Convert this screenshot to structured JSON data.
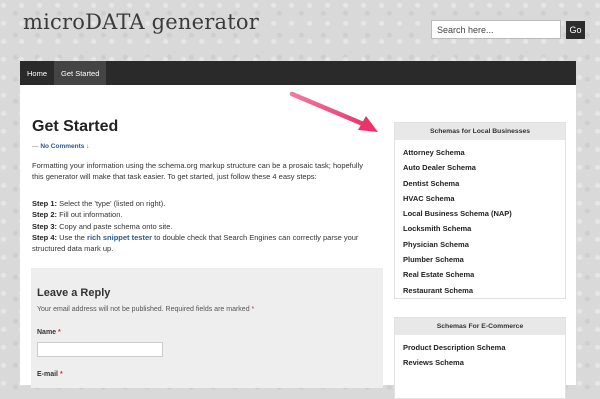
{
  "site": {
    "title": "microDATA generator"
  },
  "search": {
    "placeholder": "Search here...",
    "button_label": "Go"
  },
  "nav": {
    "items": [
      "Home",
      "Get Started"
    ]
  },
  "page": {
    "title": "Get Started",
    "meta_prefix": "— ",
    "meta_comments": "No Comments ↓",
    "intro": "Formatting your information using the schema.org markup structure can be a prosaic task; hopefully this generator will make that task easier. To get started, just follow these 4 easy steps:",
    "steps": [
      {
        "label": "Step 1:",
        "text": " Select the 'type' (listed on right)."
      },
      {
        "label": "Step 2:",
        "text": " Fill out information."
      },
      {
        "label": "Step 3:",
        "text": " Copy and paste schema onto site."
      },
      {
        "label": "Step 4:",
        "text_before": " Use the ",
        "link": "rich snippet tester",
        "text_after": " to double check that Search Engines can correctly parse your structured data mark up."
      }
    ]
  },
  "reply": {
    "title": "Leave a Reply",
    "note": "Your email address will not be published. Required fields are marked ",
    "required_mark": "*",
    "name_label": "Name ",
    "email_label": "E-mail "
  },
  "sidebar": {
    "local": {
      "title": "Schemas for Local Businesses",
      "items": [
        "Attorney Schema",
        "Auto Dealer Schema",
        "Dentist Schema",
        "HVAC Schema",
        "Local Business Schema (NAP)",
        "Locksmith Schema",
        "Physician Schema",
        "Plumber Schema",
        "Real Estate Schema",
        "Restaurant Schema"
      ]
    },
    "ecommerce": {
      "title": "Schemas For E-Commerce",
      "items": [
        "Product Description Schema",
        "Reviews Schema"
      ]
    }
  },
  "colors": {
    "accent_link": "#2a5b8c",
    "nav_bg": "#2a2a2a",
    "arrow": "#e8336b"
  }
}
